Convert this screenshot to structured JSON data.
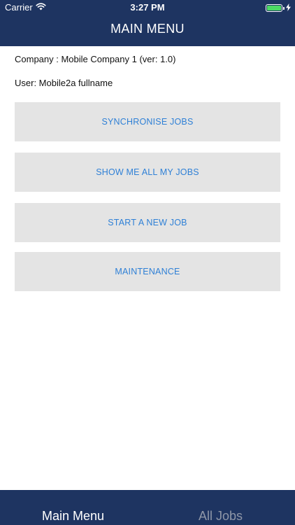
{
  "status_bar": {
    "carrier": "Carrier",
    "time": "3:27 PM",
    "battery_level": 1.0
  },
  "nav": {
    "title": "MAIN MENU"
  },
  "info": {
    "company": "Company : Mobile Company 1 (ver: 1.0)",
    "user": "User: Mobile2a fullname"
  },
  "menu": {
    "items": [
      {
        "label": "SYNCHRONISE JOBS"
      },
      {
        "label": "SHOW ME ALL MY JOBS"
      },
      {
        "label": "START A NEW JOB"
      },
      {
        "label": "MAINTENANCE"
      }
    ]
  },
  "tabs": {
    "items": [
      {
        "label": "Main Menu",
        "selected": true
      },
      {
        "label": "All Jobs",
        "selected": false
      }
    ]
  },
  "colors": {
    "bar_background": "#1e3461",
    "button_background": "#e4e4e4",
    "button_text": "#2f80d6",
    "battery_fill": "#4cd964"
  },
  "icons": {
    "wifi": "wifi-icon",
    "battery": "battery-icon",
    "charging": "charging-bolt-icon"
  }
}
